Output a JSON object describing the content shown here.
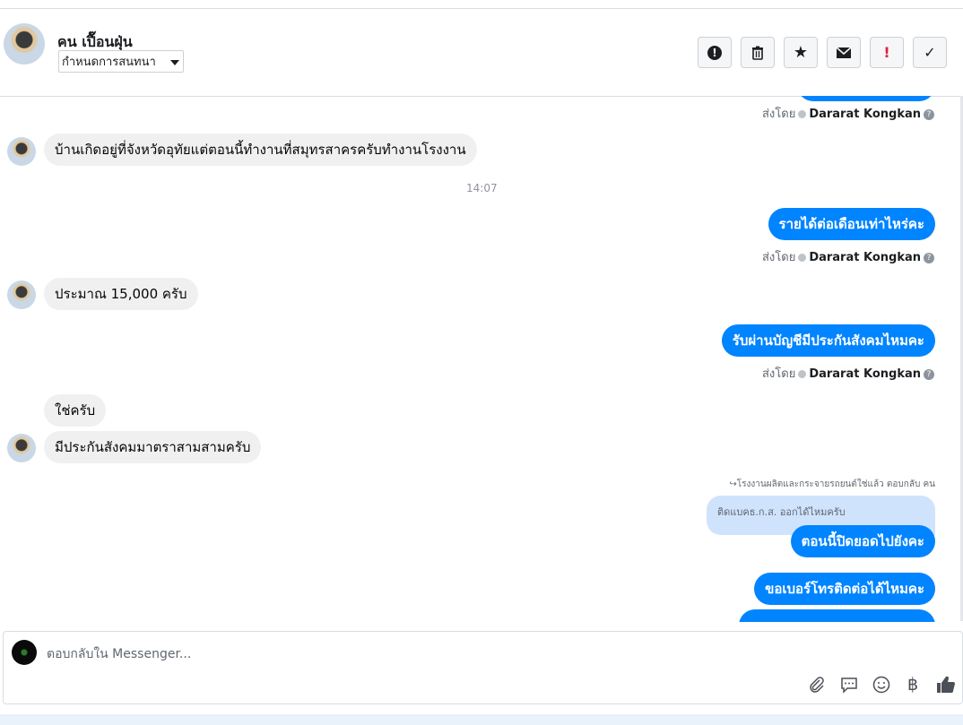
{
  "header": {
    "name": "คน เปื๊อนฝุ่น",
    "dropdown_label": "กำหนดการสนทนา",
    "buttons": [
      {
        "icon": "spam-icon",
        "glyph": "●"
      },
      {
        "icon": "trash-icon",
        "glyph": "🗑"
      },
      {
        "icon": "star-icon",
        "glyph": "★"
      },
      {
        "icon": "envelope-icon",
        "glyph": "✉"
      },
      {
        "icon": "important-icon",
        "glyph": "!"
      },
      {
        "icon": "checkmark-icon",
        "glyph": "✓"
      }
    ]
  },
  "thread": {
    "sent_by_prefix": "ส่งโดย",
    "sent_by_name": "Dararat Kongkan",
    "help_glyph": "?",
    "messages": [
      {
        "from": "in",
        "text": "บ้านเกิดอยู่ที่จังหวัดอุทัยแต่ตอนนี้ทำงานที่สมุทรสาครครับทำงานโรงงาน"
      },
      {
        "type": "time",
        "text": "14:07"
      },
      {
        "from": "out",
        "text": "รายได้ต่อเดือนเท่าไหร่คะ"
      },
      {
        "from": "in",
        "text": "ประมาณ 15,000 ครับ"
      },
      {
        "from": "out",
        "text": "รับผ่านบัญชีมีประกันสังคมไหมคะ"
      },
      {
        "from": "in",
        "text": "ใช่ครับ"
      },
      {
        "from": "in",
        "text": "มีประกันสังคมมาตราสามสามครับ"
      },
      {
        "type": "reply_note",
        "text": "โรงงานผลิตและกระจายรถยนต์ใช่แล้ว ตอบกลับ คน"
      },
      {
        "type": "quoted",
        "text": "ติดแบคธ.ก.ส. ออกได้ไหมครับ"
      },
      {
        "from": "out",
        "text": "ตอนนี้ปิดยอดไปยังคะ"
      },
      {
        "from": "out",
        "text": "ขอเบอร์โทรติดต่อได้ไหมคะ"
      }
    ]
  },
  "composer": {
    "placeholder": "ตอบกลับใน Messenger...",
    "icons": [
      "paperclip-icon",
      "saved-reply-icon",
      "emoji-icon",
      "baht-icon",
      "like-icon"
    ]
  }
}
